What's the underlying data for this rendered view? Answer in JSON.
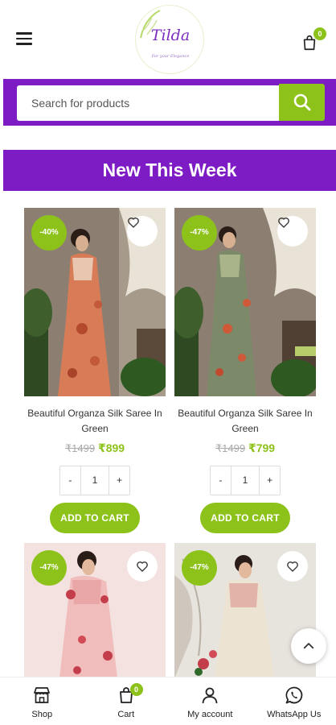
{
  "header": {
    "logo_text": "Tilda",
    "logo_tagline": "For your Elegance",
    "cart_count": "0"
  },
  "search": {
    "placeholder": "Search for products"
  },
  "section": {
    "title": "New This Week"
  },
  "products": [
    {
      "discount": "-40%",
      "title": "Beautiful Organza Silk Saree In Green",
      "old_price": "₹1499",
      "new_price": "₹899",
      "qty": "1",
      "add_label": "ADD TO CART"
    },
    {
      "discount": "-47%",
      "title": "Beautiful Organza Silk Saree In Green",
      "old_price": "₹1499",
      "new_price": "₹799",
      "qty": "1",
      "add_label": "ADD TO CART"
    },
    {
      "discount": "-47%"
    },
    {
      "discount": "-47%"
    }
  ],
  "qty_controls": {
    "minus": "-",
    "plus": "+"
  },
  "bottom_nav": [
    {
      "label": "Shop",
      "icon": "store-icon"
    },
    {
      "label": "Cart",
      "icon": "shopping-bag-icon",
      "badge": "0"
    },
    {
      "label": "My account",
      "icon": "user-icon"
    },
    {
      "label": "WhatsApp Us",
      "icon": "whatsapp-icon"
    }
  ],
  "colors": {
    "purple": "#7d1cc4",
    "green": "#8cc21a"
  }
}
